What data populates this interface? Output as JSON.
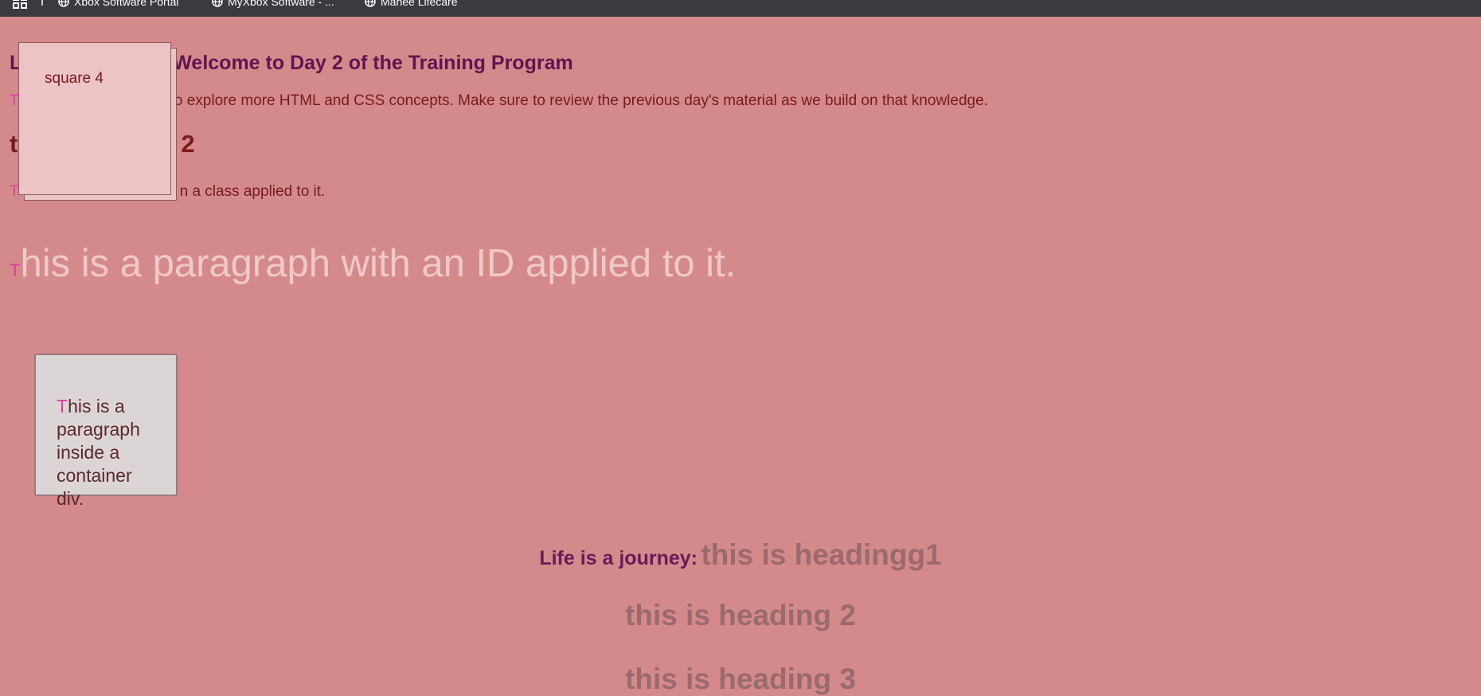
{
  "browser": {
    "bookmarks": [
      {
        "label": "Xbox Software Portal"
      },
      {
        "label": "MyXbox Software - ..."
      },
      {
        "label": "Mahee Lifecare"
      }
    ]
  },
  "content": {
    "welcome_heading": "Welcome to Day 2 of the Training Program",
    "welcome_heading_prefix": "L",
    "intro_first_letter": "T",
    "intro_text": "to explore more HTML and CSS concepts. Make sure to review the previous day's material as we build on that knowledge.",
    "tag_heading_prefix": "t",
    "tag_heading_suffix": "2",
    "class_first_letter": "T",
    "class_text_tail": "n a class applied to it.",
    "id_first_letter": "T",
    "id_text": "his is a paragraph with an ID applied to it.",
    "square_label": "square 4",
    "container_first_letter": "T",
    "container_text": "his is a paragraph inside a container div.",
    "life_label": "Life is a journey:",
    "heading1": "this is headingg1",
    "heading2": "this is heading 2",
    "heading3": "this is heading 3"
  },
  "colors": {
    "page_bg": "#d48a8a",
    "first_letter": "#e23aa6",
    "browser_bar": "#3a3a3f"
  }
}
